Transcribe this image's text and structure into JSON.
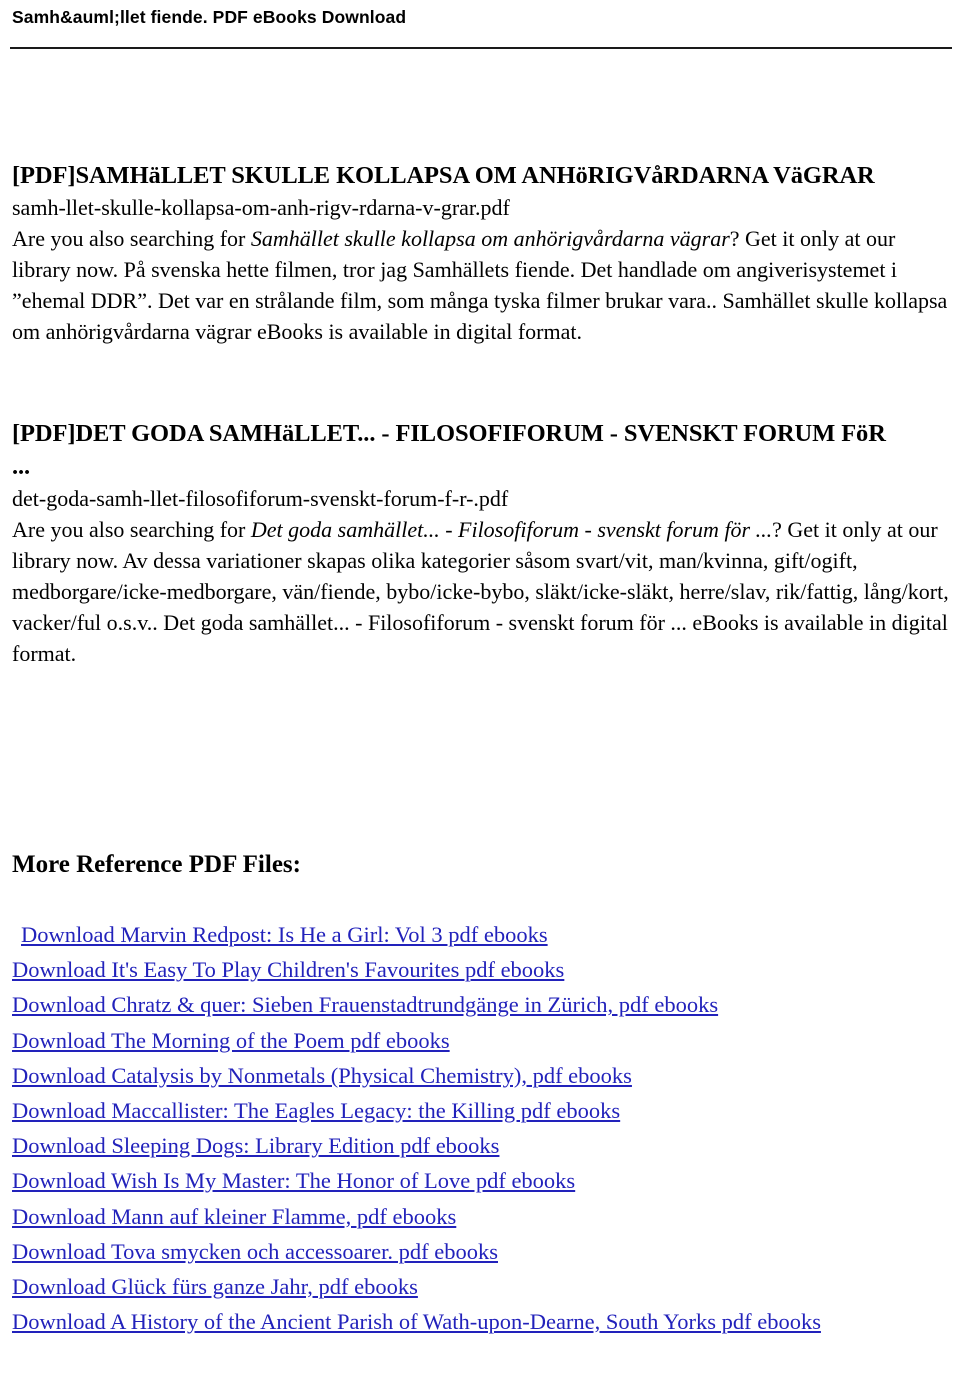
{
  "header": {
    "title": "Samh&auml;llet fiende. PDF eBooks Download"
  },
  "entries": [
    {
      "title": "[PDF]SAMHäLLET SKULLE KOLLAPSA OM ANHöRIGVåRDARNA VäGRAR",
      "filename": "samh-llet-skulle-kollapsa-om-anh-rigv-rdarna-v-grar.pdf",
      "body_lead": "Are you also searching for ",
      "body_italic": "Samhället skulle kollapsa om anhörigvårdarna vägrar",
      "body_rest": "? Get it only at our library now. På svenska hette filmen, tror jag Samhällets fiende. Det handlade om angiverisystemet i ”ehemal DDR”. Det var en strålande film, som många tyska filmer brukar vara.. Samhället skulle kollapsa om anhörigvårdarna vägrar eBooks is available in digital format."
    },
    {
      "title": "[PDF]DET GODA SAMHäLLET... - FILOSOFIFORUM - SVENSKT FORUM FöR",
      "title_cont": "...",
      "filename": "det-goda-samh-llet-filosofiforum-svenskt-forum-f-r-.pdf",
      "body_lead": "Are you also searching for ",
      "body_italic": "Det goda samhället... - Filosofiforum - svenskt forum för ...",
      "body_rest": "? Get it only at our library now. Av dessa variationer skapas olika kategorier såsom svart/vit, man/kvinna, gift/ogift, medborgare/icke-medborgare, vän/fiende, bybo/icke-bybo, släkt/icke-släkt, herre/slav, rik/fattig, lång/kort, vacker/ful o.s.v.. Det goda samhället... - Filosofiforum - svenskt forum för ... eBooks is available in digital format."
    }
  ],
  "more_reference": {
    "heading": "More Reference PDF Files:",
    "links": [
      "Download Marvin Redpost: Is He a Girl: Vol 3 pdf ebooks",
      "Download It's Easy To Play Children's Favourites pdf ebooks",
      "Download Chratz & quer: Sieben Frauenstadtrundgänge in Zürich, pdf ebooks",
      "Download The Morning of the Poem pdf ebooks",
      "Download Catalysis by Nonmetals (Physical Chemistry), pdf ebooks",
      "Download Maccallister: The Eagles Legacy: the Killing pdf ebooks",
      "Download Sleeping Dogs: Library Edition pdf ebooks",
      "Download Wish Is My Master: The Honor of Love pdf ebooks",
      "Download Mann auf kleiner Flamme, pdf ebooks",
      "Download Tova smycken och accessoarer. pdf ebooks",
      "Download Glück fürs ganze Jahr, pdf ebooks",
      "Download A History of the Ancient Parish of Wath-upon-Dearne, South Yorks pdf ebooks"
    ]
  },
  "colors": {
    "link": "#2222bb",
    "text": "#000000",
    "rule": "#1a1a1a"
  }
}
